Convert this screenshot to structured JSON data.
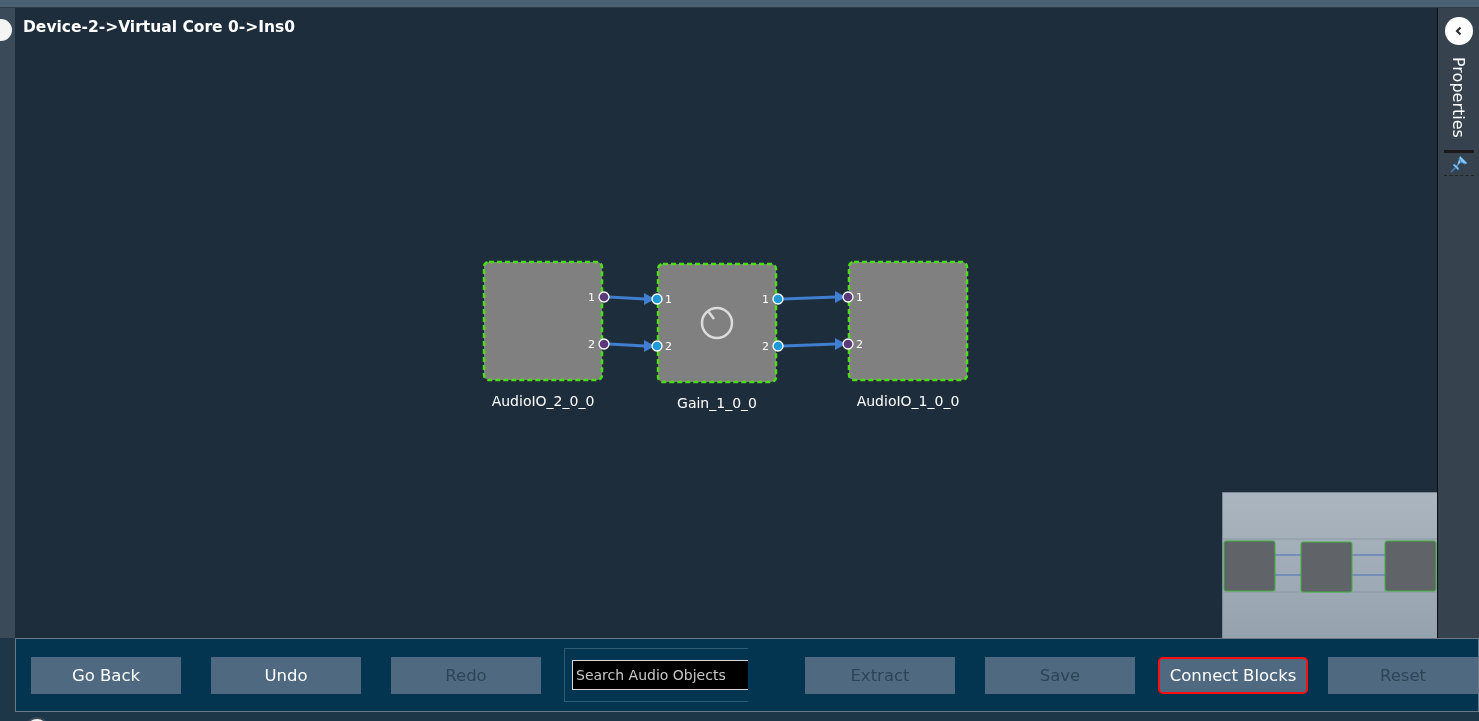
{
  "breadcrumb": "Device-2->Virtual Core 0->Ins0",
  "blocks": [
    {
      "name": "AudioIO_2_0_0",
      "kind": "io",
      "outputs": [
        "1",
        "2"
      ]
    },
    {
      "name": "Gain_1_0_0",
      "kind": "gain",
      "inputs": [
        "1",
        "2"
      ],
      "outputs": [
        "1",
        "2"
      ]
    },
    {
      "name": "AudioIO_1_0_0",
      "kind": "io",
      "inputs": [
        "1",
        "2"
      ]
    }
  ],
  "properties_panel": {
    "title": "Properties",
    "pinned": true
  },
  "toolbar": [
    {
      "kind": "button",
      "label": "Go Back",
      "disabled": false,
      "focused": false
    },
    {
      "kind": "button",
      "label": "Undo",
      "disabled": false,
      "focused": false
    },
    {
      "kind": "button",
      "label": "Redo",
      "disabled": true,
      "focused": false
    },
    {
      "kind": "search",
      "placeholder": "Search Audio Objects"
    },
    {
      "kind": "button",
      "label": "Extract",
      "disabled": true,
      "focused": false
    },
    {
      "kind": "button",
      "label": "Save",
      "disabled": true,
      "focused": false
    },
    {
      "kind": "button",
      "label": "Connect Blocks",
      "disabled": false,
      "focused": true
    },
    {
      "kind": "button",
      "label": "Reset",
      "disabled": true,
      "focused": false
    }
  ]
}
